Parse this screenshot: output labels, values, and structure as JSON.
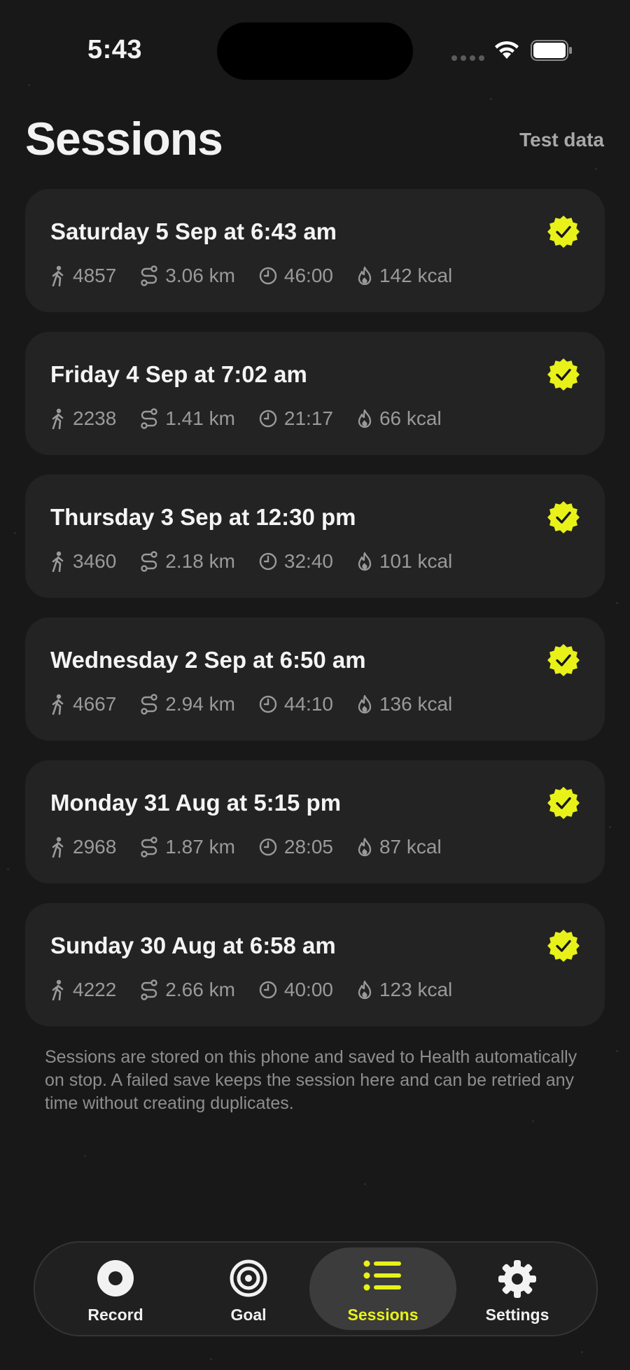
{
  "status_bar": {
    "time": "5:43"
  },
  "header": {
    "title": "Sessions",
    "test_data_label": "Test data"
  },
  "colors": {
    "accent": "#e8f219",
    "background": "#181818",
    "card": "#232323",
    "muted_text": "#9a9a9a"
  },
  "sessions": [
    {
      "date": "Saturday 5 Sep at 6:43 am",
      "steps": "4857",
      "distance": "3.06 km",
      "duration": "46:00",
      "calories": "142 kcal",
      "saved": true
    },
    {
      "date": "Friday 4 Sep at 7:02 am",
      "steps": "2238",
      "distance": "1.41 km",
      "duration": "21:17",
      "calories": "66 kcal",
      "saved": true
    },
    {
      "date": "Thursday 3 Sep at 12:30 pm",
      "steps": "3460",
      "distance": "2.18 km",
      "duration": "32:40",
      "calories": "101 kcal",
      "saved": true
    },
    {
      "date": "Wednesday 2 Sep at 6:50 am",
      "steps": "4667",
      "distance": "2.94 km",
      "duration": "44:10",
      "calories": "136 kcal",
      "saved": true
    },
    {
      "date": "Monday 31 Aug at 5:15 pm",
      "steps": "2968",
      "distance": "1.87 km",
      "duration": "28:05",
      "calories": "87 kcal",
      "saved": true
    },
    {
      "date": "Sunday 30 Aug at 6:58 am",
      "steps": "4222",
      "distance": "2.66 km",
      "duration": "40:00",
      "calories": "123 kcal",
      "saved": true
    }
  ],
  "footer_note": "Sessions are stored on this phone and saved to Health automatically on stop. A failed save keeps the session here and can be retried any time without creating duplicates.",
  "tabbar": {
    "tabs": [
      {
        "label": "Record",
        "icon": "record-icon",
        "active": false
      },
      {
        "label": "Goal",
        "icon": "target-icon",
        "active": false
      },
      {
        "label": "Sessions",
        "icon": "list-icon",
        "active": true
      },
      {
        "label": "Settings",
        "icon": "gear-icon",
        "active": false
      }
    ]
  }
}
